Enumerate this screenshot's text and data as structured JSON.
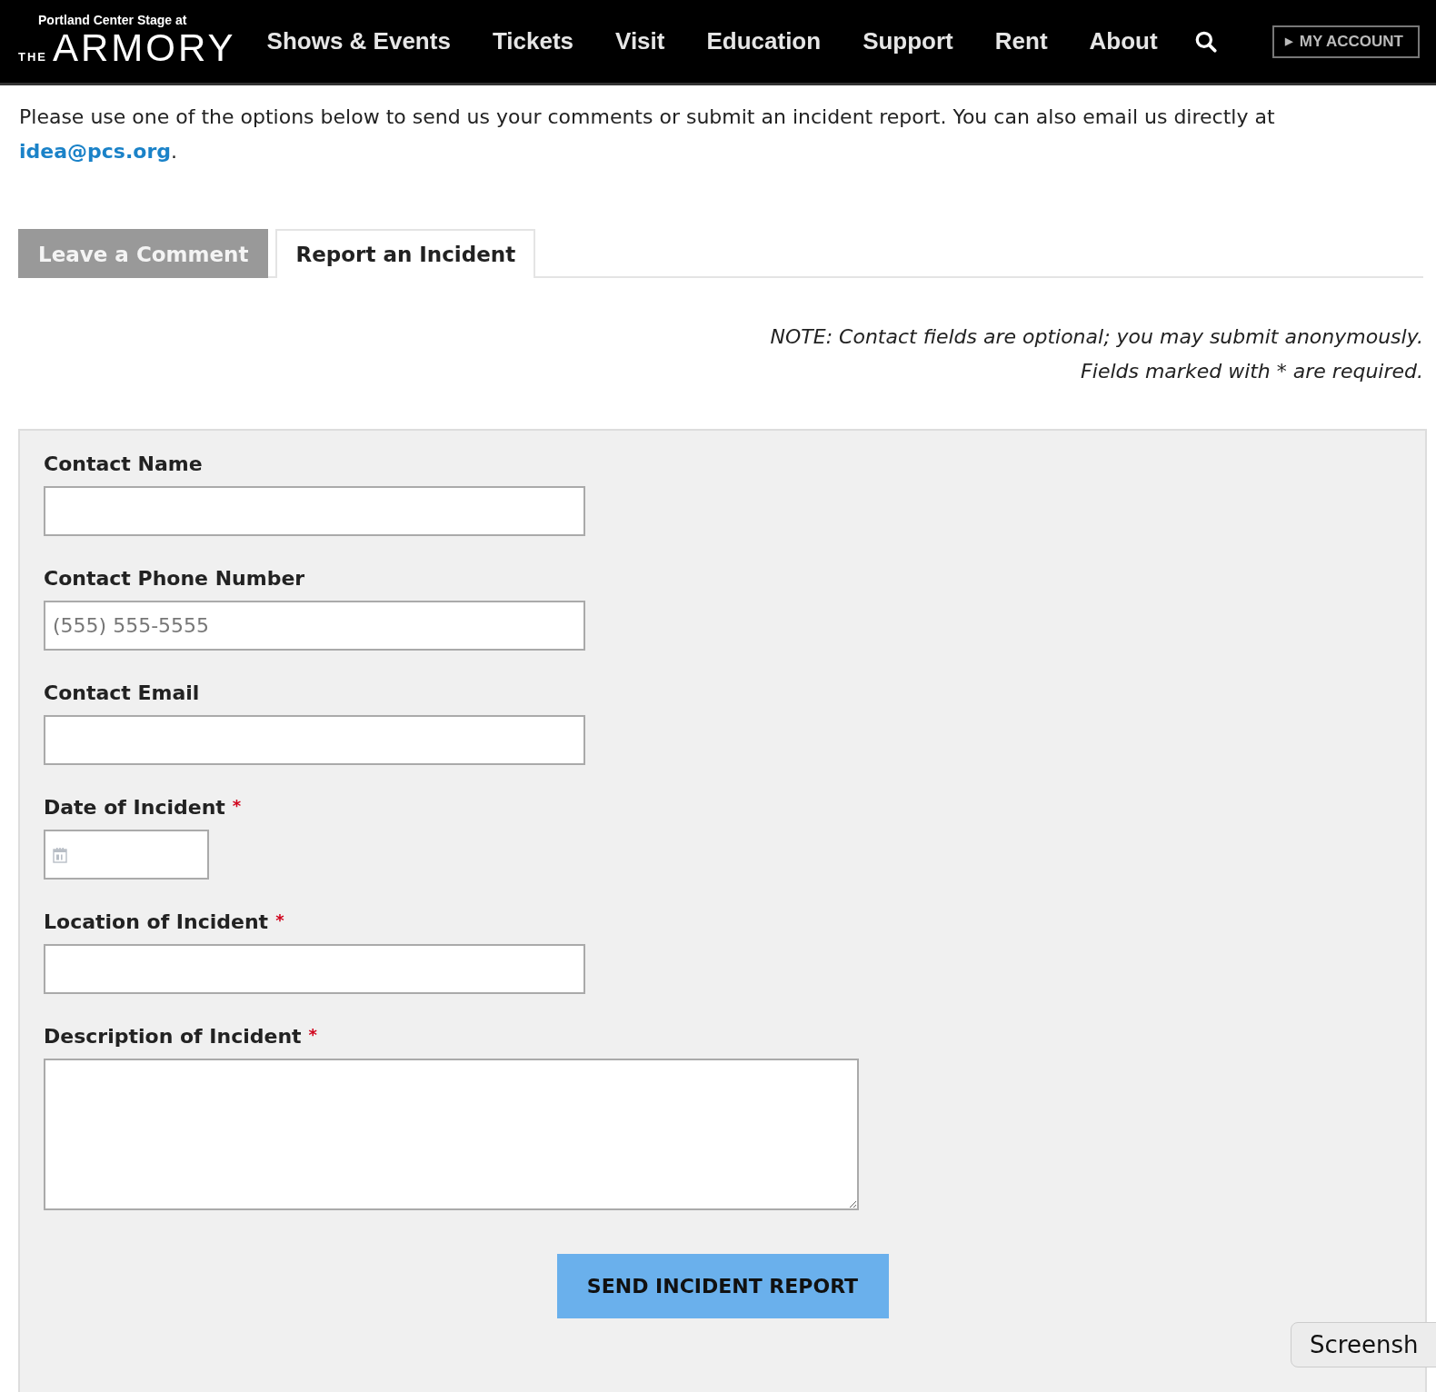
{
  "header": {
    "logo": {
      "tagline": "Portland Center Stage at",
      "prefix": "THE",
      "name": "ARMORY"
    },
    "nav": [
      {
        "label": "Shows & Events"
      },
      {
        "label": "Tickets"
      },
      {
        "label": "Visit"
      },
      {
        "label": "Education"
      },
      {
        "label": "Support"
      },
      {
        "label": "Rent"
      },
      {
        "label": "About"
      }
    ],
    "account_button": {
      "icon": "▶",
      "label": "MY ACCOUNT"
    }
  },
  "intro": {
    "text": "Please use one of the options below to send us your comments or submit an incident report. You can also email us directly at ",
    "link": "idea@pcs.org",
    "after": "."
  },
  "tabs": [
    {
      "label": "Leave a Comment",
      "selected": false
    },
    {
      "label": "Report an Incident",
      "selected": true
    }
  ],
  "notes": [
    "NOTE: Contact fields are optional; you may submit anonymously.",
    "Fields marked with * are required."
  ],
  "form": {
    "fields": [
      {
        "kind": "text",
        "label": "Contact Name"
      },
      {
        "kind": "text",
        "label": "Contact Phone Number",
        "placeholder": "(555) 555-5555"
      },
      {
        "kind": "text",
        "label": "Contact Email"
      },
      {
        "kind": "date",
        "label": "Date of Incident",
        "marker": "*"
      },
      {
        "kind": "text",
        "label": "Location of Incident",
        "marker": "*"
      },
      {
        "kind": "textarea",
        "label": "Description of Incident",
        "marker": "*"
      }
    ],
    "submit": "SEND INCIDENT REPORT"
  },
  "tooltip": {
    "text": "Screensh"
  }
}
